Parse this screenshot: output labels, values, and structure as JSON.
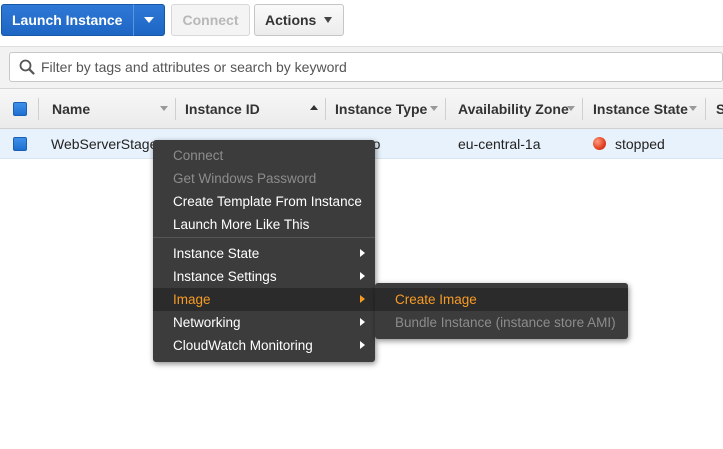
{
  "toolbar": {
    "launch_label": "Launch Instance",
    "connect_label": "Connect",
    "actions_label": "Actions"
  },
  "search": {
    "placeholder": "Filter by tags and attributes or search by keyword"
  },
  "table": {
    "columns": [
      "Name",
      "Instance ID",
      "Instance Type",
      "Availability Zone",
      "Instance State",
      "S"
    ],
    "rows": [
      {
        "name": "WebServerStage",
        "instance_type": "ro",
        "availability_zone": "eu-central-1a",
        "instance_state": "stopped"
      }
    ]
  },
  "context_menu": {
    "items": [
      {
        "label": "Connect",
        "disabled": true
      },
      {
        "label": "Get Windows Password",
        "disabled": true
      },
      {
        "label": "Create Template From Instance"
      },
      {
        "label": "Launch More Like This"
      },
      {
        "label": "Instance State",
        "submenu": true
      },
      {
        "label": "Instance Settings",
        "submenu": true
      },
      {
        "label": "Image",
        "submenu": true,
        "active": true
      },
      {
        "label": "Networking",
        "submenu": true
      },
      {
        "label": "CloudWatch Monitoring",
        "submenu": true
      }
    ]
  },
  "image_submenu": {
    "items": [
      {
        "label": "Create Image",
        "active": true
      },
      {
        "label": "Bundle Instance (instance store AMI)",
        "disabled": true
      }
    ]
  },
  "colors": {
    "primary": "#1d66c3",
    "menu_bg": "#3c3c3c",
    "menu_highlight": "#f79b25",
    "row_selected": "#e8f2fc",
    "stopped": "#e0401e"
  }
}
